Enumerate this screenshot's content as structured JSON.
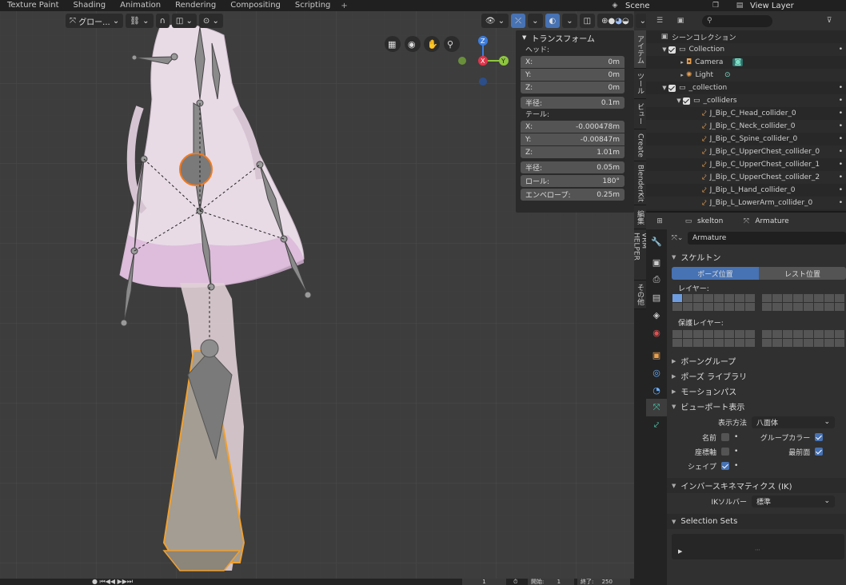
{
  "topbar": {
    "tabs": [
      "Texture Paint",
      "Shading",
      "Animation",
      "Rendering",
      "Compositing",
      "Scripting"
    ],
    "plus": "+",
    "scene": "Scene",
    "view_layer": "View Layer"
  },
  "viewport": {
    "transform_orientation": "グロー...",
    "gizmo": {
      "z": "Z",
      "x": "X",
      "y": "Y"
    }
  },
  "npanel": {
    "title": "トランスフォーム",
    "head_label": "ヘッド:",
    "head": [
      {
        "k": "X:",
        "v": "0m"
      },
      {
        "k": "Y:",
        "v": "0m"
      },
      {
        "k": "Z:",
        "v": "0m"
      }
    ],
    "head_radius": {
      "k": "半径:",
      "v": "0.1m"
    },
    "tail_label": "テール:",
    "tail": [
      {
        "k": "X:",
        "v": "-0.000478m"
      },
      {
        "k": "Y:",
        "v": "-0.00847m"
      },
      {
        "k": "Z:",
        "v": "1.01m"
      }
    ],
    "tail_radius": {
      "k": "半径:",
      "v": "0.05m"
    },
    "roll": {
      "k": "ロール:",
      "v": "180°"
    },
    "envelope": {
      "k": "エンベロープ:",
      "v": "0.25m"
    }
  },
  "vtabs": [
    "アイテム",
    "ツール",
    "ビュー",
    "Create",
    "BlenderKit",
    "編集",
    "VRM HELPER",
    "その他"
  ],
  "outliner": {
    "rows": [
      {
        "label": "シーンコレクション",
        "indent": 0,
        "type": "scene"
      },
      {
        "label": "Collection",
        "indent": 1,
        "type": "collection"
      },
      {
        "label": "Camera",
        "indent": 2,
        "type": "camera"
      },
      {
        "label": "Light",
        "indent": 2,
        "type": "light"
      },
      {
        "label": "_collection",
        "indent": 1,
        "type": "collection"
      },
      {
        "label": "_colliders",
        "indent": 2,
        "type": "collection"
      },
      {
        "label": "J_Bip_C_Head_collider_0",
        "indent": 3,
        "type": "bone"
      },
      {
        "label": "J_Bip_C_Neck_collider_0",
        "indent": 3,
        "type": "bone"
      },
      {
        "label": "J_Bip_C_Spine_collider_0",
        "indent": 3,
        "type": "bone"
      },
      {
        "label": "J_Bip_C_UpperChest_collider_0",
        "indent": 3,
        "type": "bone"
      },
      {
        "label": "J_Bip_C_UpperChest_collider_1",
        "indent": 3,
        "type": "bone"
      },
      {
        "label": "J_Bip_C_UpperChest_collider_2",
        "indent": 3,
        "type": "bone"
      },
      {
        "label": "J_Bip_L_Hand_collider_0",
        "indent": 3,
        "type": "bone"
      },
      {
        "label": "J_Bip_L_LowerArm_collider_0",
        "indent": 3,
        "type": "bone"
      }
    ]
  },
  "properties": {
    "breadcrumb_object": "skelton",
    "breadcrumb_data": "Armature",
    "datablock": "Armature",
    "skeleton_title": "スケルトン",
    "pose_position": "ポーズ位置",
    "rest_position": "レスト位置",
    "layers_label": "レイヤー:",
    "protected_layers_label": "保護レイヤー:",
    "bone_groups": "ボーングループ",
    "pose_library": "ポーズ ライブラリ",
    "motion_paths": "モーションパス",
    "viewport_display": "ビューポート表示",
    "display_as_label": "表示方法",
    "display_as_value": "八面体",
    "names": "名前",
    "axes": "座標軸",
    "shapes": "シェイプ",
    "group_colors": "グループカラー",
    "in_front": "最前面",
    "ik_title": "インバースキネマティクス (IK)",
    "ik_solver_label": "IKソルバー",
    "ik_solver_value": "標準",
    "selection_sets": "Selection Sets"
  },
  "timeline": {
    "frame": "1",
    "start_label": "開始:",
    "start": "1",
    "end_label": "終了:",
    "end": "250"
  }
}
